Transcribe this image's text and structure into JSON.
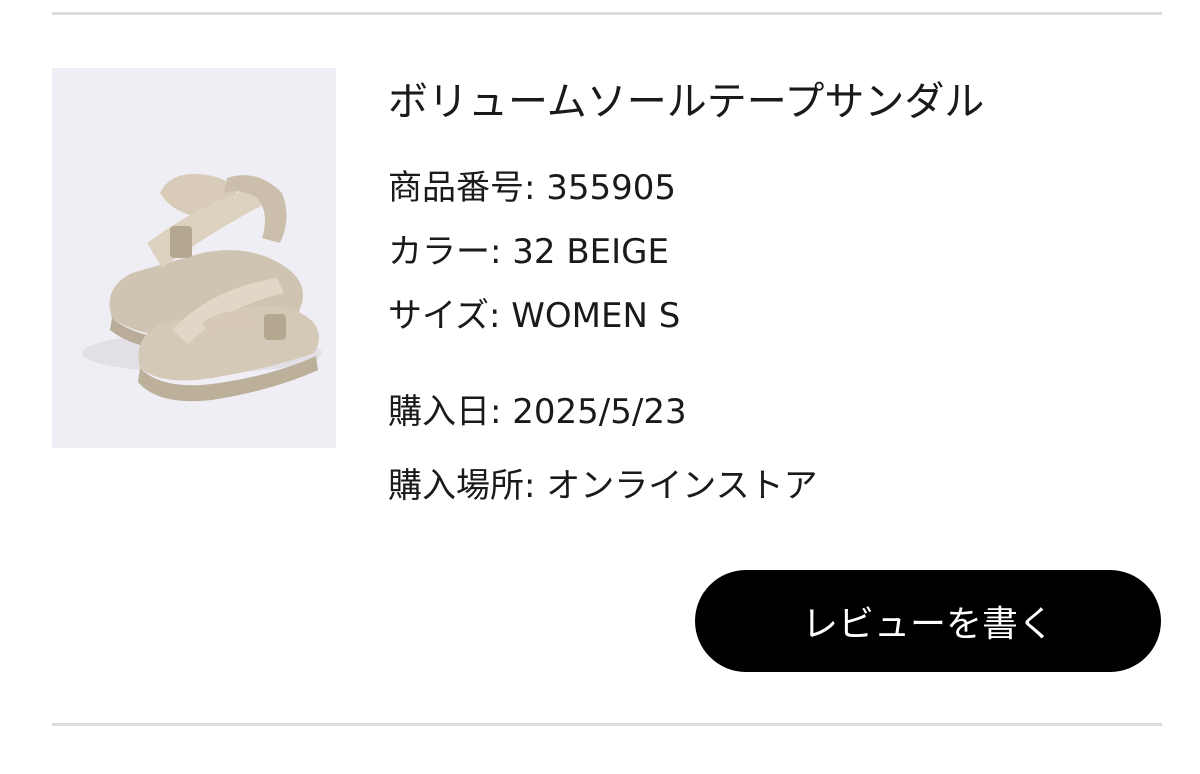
{
  "product": {
    "name": "ボリュームソールテープサンダル",
    "image_icon": "beige-sandal-product-image",
    "details": [
      {
        "label": "商品番号",
        "value": "355905"
      },
      {
        "label": "カラー",
        "value": "32 BEIGE"
      },
      {
        "label": "サイズ",
        "value": "WOMEN S"
      }
    ],
    "purchase": [
      {
        "label": "購入日",
        "value": "2025/5/23"
      },
      {
        "label": "購入場所",
        "value": "オンラインストア"
      }
    ]
  },
  "actions": {
    "review_label": "レビューを書く"
  },
  "colors": {
    "button_bg": "#000000",
    "button_text": "#ffffff",
    "divider": "#dcdcdc",
    "image_bg": "#efeef4"
  }
}
